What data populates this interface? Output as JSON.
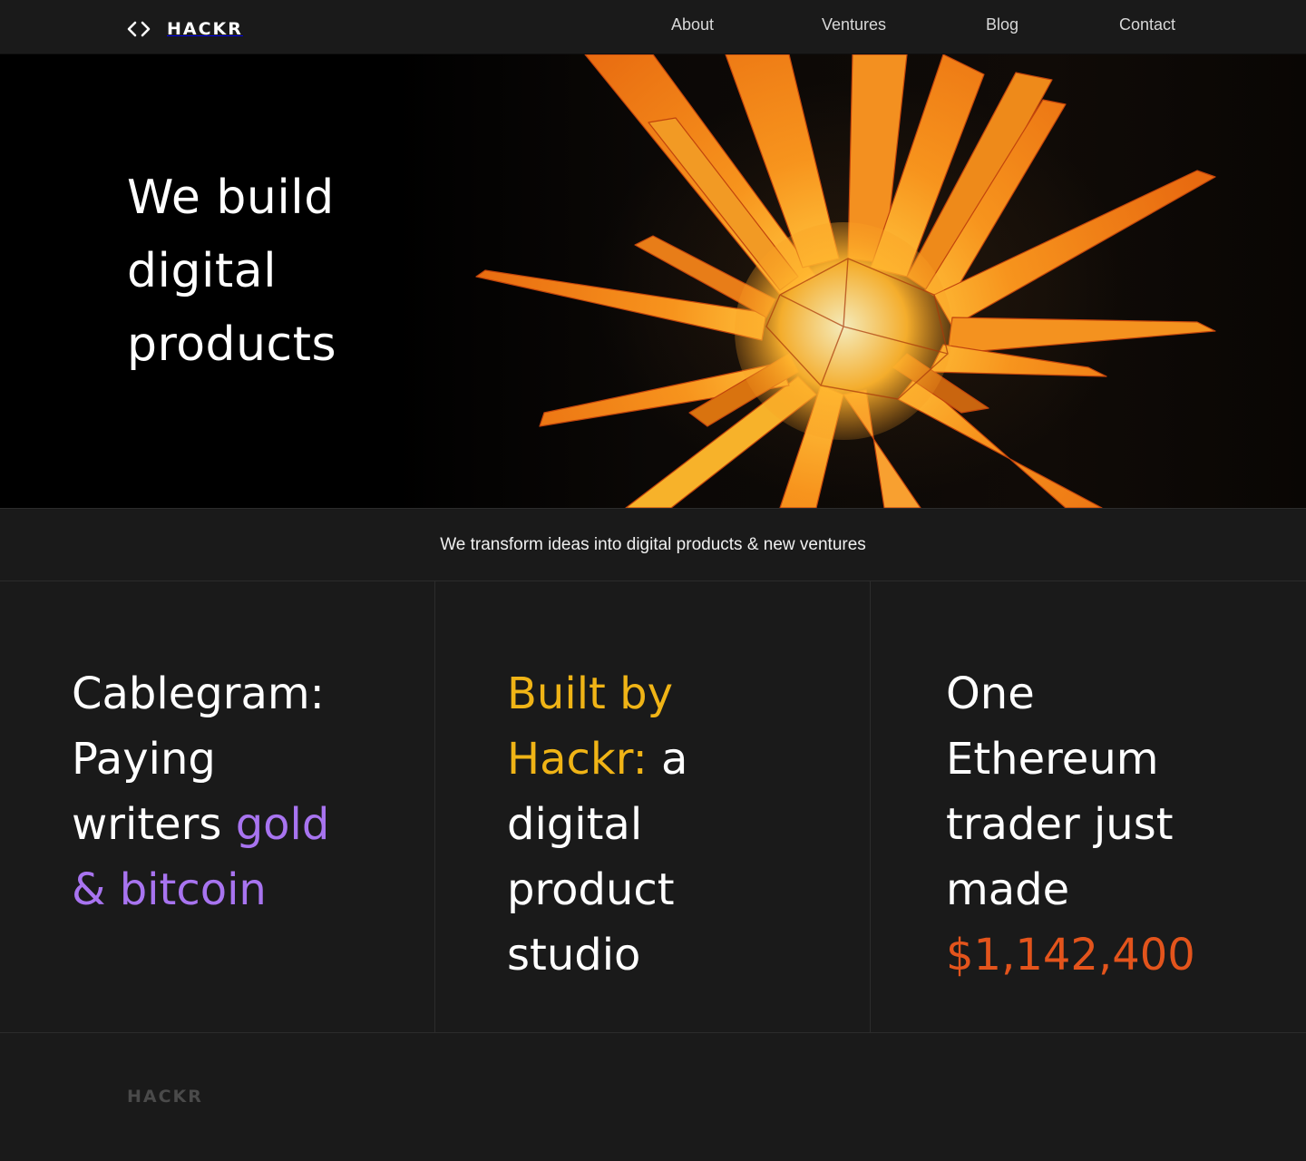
{
  "brand": {
    "name": "HACKR",
    "icon": "code-brackets-icon"
  },
  "nav": {
    "items": [
      "About",
      "Ventures",
      "Blog",
      "Contact"
    ]
  },
  "hero": {
    "title_lines": [
      "We build",
      "digital",
      "products"
    ]
  },
  "tagline": "We transform ideas into digital products & new ventures",
  "cards": [
    {
      "lines": [
        [
          {
            "text": "Cablegram:",
            "tone": "white"
          }
        ],
        [
          {
            "text": "Paying",
            "tone": "white"
          }
        ],
        [
          {
            "text": "writers ",
            "tone": "white"
          },
          {
            "text": "gold",
            "tone": "purple"
          }
        ],
        [
          {
            "text": "& bitcoin",
            "tone": "purple"
          }
        ]
      ]
    },
    {
      "lines": [
        [
          {
            "text": "Built by",
            "tone": "gold"
          }
        ],
        [
          {
            "text": "Hackr:",
            "tone": "gold"
          },
          {
            "text": " a",
            "tone": "white"
          }
        ],
        [
          {
            "text": "digital",
            "tone": "white"
          }
        ],
        [
          {
            "text": "product",
            "tone": "white"
          }
        ],
        [
          {
            "text": "studio",
            "tone": "white"
          }
        ]
      ]
    },
    {
      "lines": [
        [
          {
            "text": "One",
            "tone": "white"
          }
        ],
        [
          {
            "text": "Ethereum",
            "tone": "white"
          }
        ],
        [
          {
            "text": "trader just",
            "tone": "white"
          }
        ],
        [
          {
            "text": "made",
            "tone": "white"
          }
        ],
        [
          {
            "text": "$1,142,400",
            "tone": "orange"
          }
        ]
      ]
    }
  ],
  "footer": {
    "brand": "HACKR"
  },
  "colors": {
    "background": "#1a1a1a",
    "hero_background": "#000000",
    "purple": "#a874f0",
    "gold": "#f0b416",
    "orange": "#e3541c",
    "star_orange": "#f7941d"
  }
}
